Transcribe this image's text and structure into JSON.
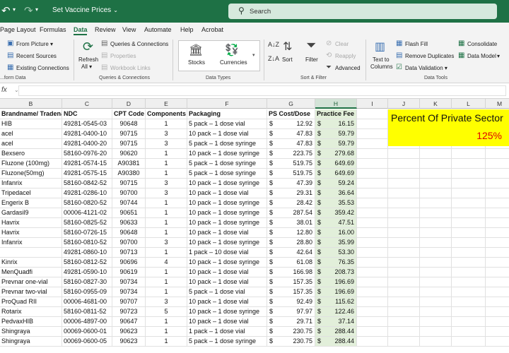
{
  "titlebar": {
    "doc_title": "Set Vaccine Prices",
    "search_placeholder": "Search"
  },
  "tabs": [
    "Page Layout",
    "Formulas",
    "Data",
    "Review",
    "View",
    "Automate",
    "Help",
    "Acrobat"
  ],
  "active_tab": "Data",
  "ribbon": {
    "get_data": {
      "from_picture": "From Picture",
      "recent_sources": "Recent Sources",
      "existing_connections": "Existing Connections",
      "label": "...form Data"
    },
    "queries": {
      "refresh_all": "Refresh",
      "refresh_all_2": "All",
      "queries_connections": "Queries & Connections",
      "properties": "Properties",
      "workbook_links": "Workbook Links",
      "label": "Queries & Connections"
    },
    "data_types": {
      "stocks": "Stocks",
      "currencies": "Currencies",
      "label": "Data Types"
    },
    "sort_filter": {
      "sort": "Sort",
      "filter": "Filter",
      "clear": "Clear",
      "reapply": "Reapply",
      "advanced": "Advanced",
      "label": "Sort & Filter"
    },
    "data_tools": {
      "text_to_columns": "Text to",
      "text_to_columns_2": "Columns",
      "flash_fill": "Flash Fill",
      "remove_duplicates": "Remove Duplicates",
      "data_validation": "Data Validation",
      "consolidate": "Consolidate",
      "data_model": "Data Model",
      "label": "Data Tools"
    }
  },
  "formula_bar": {
    "fx": "fx",
    "value": ""
  },
  "columns": [
    "B",
    "C",
    "D",
    "E",
    "F",
    "G",
    "H",
    "I",
    "J",
    "K",
    "L",
    "M"
  ],
  "selected_column": "H",
  "header_row": {
    "name": "Brandname/ Tradename",
    "ndc": "NDC",
    "cpt": "CPT Code",
    "components": "Components",
    "packaging": "Packaging",
    "ps_cost": "PS Cost/Dose",
    "practice_fee": "Practice Fee"
  },
  "banner": {
    "title": "Percent Of Private Sector",
    "value": "125%"
  },
  "rows": [
    {
      "name": "HIB",
      "ndc": "49281-0545-03",
      "cpt": "90648",
      "comp": "1",
      "pack": "5 pack – 1 dose vial",
      "cost": "12.92",
      "fee": "16.15"
    },
    {
      "name": "acel",
      "ndc": "49281-0400-10",
      "cpt": "90715",
      "comp": "3",
      "pack": "10 pack – 1 dose vial",
      "cost": "47.83",
      "fee": "59.79"
    },
    {
      "name": "acel",
      "ndc": "49281-0400-20",
      "cpt": "90715",
      "comp": "3",
      "pack": "5 pack – 1 dose syringe",
      "cost": "47.83",
      "fee": "59.79"
    },
    {
      "name": "Bexsero",
      "ndc": "58160-0976-20",
      "cpt": "90620",
      "comp": "1",
      "pack": "10 pack – 1 dose syringe",
      "cost": "223.75",
      "fee": "279.68"
    },
    {
      "name": "Fluzone (100mg)",
      "ndc": "49281-0574-15",
      "cpt": "A90381",
      "comp": "1",
      "pack": "5 pack – 1 dose syringe",
      "cost": "519.75",
      "fee": "649.69"
    },
    {
      "name": "Fluzone(50mg)",
      "ndc": "49281-0575-15",
      "cpt": "A90380",
      "comp": "1",
      "pack": "5 pack – 1 dose syringe",
      "cost": "519.75",
      "fee": "649.69"
    },
    {
      "name": "Infanrix",
      "ndc": "58160-0842-52",
      "cpt": "90715",
      "comp": "3",
      "pack": "10 pack – 1 dose syringe",
      "cost": "47.39",
      "fee": "59.24"
    },
    {
      "name": "Tripedacel",
      "ndc": "49281-0286-10",
      "cpt": "90700",
      "comp": "3",
      "pack": "10 pack – 1 dose vial",
      "cost": "29.31",
      "fee": "36.64"
    },
    {
      "name": "Engerix B",
      "ndc": "58160-0820-52",
      "cpt": "90744",
      "comp": "1",
      "pack": "10 pack – 1 dose syringe",
      "cost": "28.42",
      "fee": "35.53"
    },
    {
      "name": "Gardasil9",
      "ndc": "00006-4121-02",
      "cpt": "90651",
      "comp": "1",
      "pack": "10 pack – 1 dose syringe",
      "cost": "287.54",
      "fee": "359.42"
    },
    {
      "name": "Havrix",
      "ndc": "58160-0825-52",
      "cpt": "90633",
      "comp": "1",
      "pack": "10 pack – 1 dose syringe",
      "cost": "38.01",
      "fee": "47.51"
    },
    {
      "name": "Havrix",
      "ndc": "58160-0726-15",
      "cpt": "90648",
      "comp": "1",
      "pack": "10 pack – 1 dose vial",
      "cost": "12.80",
      "fee": "16.00"
    },
    {
      "name": "Infanrix",
      "ndc": "58160-0810-52",
      "cpt": "90700",
      "comp": "3",
      "pack": "10 pack – 1 dose syringe",
      "cost": "28.80",
      "fee": "35.99"
    },
    {
      "name": "",
      "ndc": "49281-0860-10",
      "cpt": "90713",
      "comp": "1",
      "pack": "1 pack – 10 dose vial",
      "cost": "42.64",
      "fee": "53.30"
    },
    {
      "name": "Kinrix",
      "ndc": "58160-0812-52",
      "cpt": "90696",
      "comp": "4",
      "pack": "10 pack – 1 dose syringe",
      "cost": "61.08",
      "fee": "76.35"
    },
    {
      "name": "MenQuadfi",
      "ndc": "49281-0590-10",
      "cpt": "90619",
      "comp": "1",
      "pack": "10 pack – 1 dose vial",
      "cost": "166.98",
      "fee": "208.73"
    },
    {
      "name": "Prevnar one-vial",
      "ndc": "58160-0827-30",
      "cpt": "90734",
      "comp": "1",
      "pack": "10 pack – 1 dose vial",
      "cost": "157.35",
      "fee": "196.69"
    },
    {
      "name": "Prevnar two-vial",
      "ndc": "58160-0955-09",
      "cpt": "90734",
      "comp": "1",
      "pack": "5 pack – 1 dose vial",
      "cost": "157.35",
      "fee": "196.69"
    },
    {
      "name": "ProQuad RII",
      "ndc": "00006-4681-00",
      "cpt": "90707",
      "comp": "3",
      "pack": "10 pack – 1 dose vial",
      "cost": "92.49",
      "fee": "115.62"
    },
    {
      "name": "Rotarix",
      "ndc": "58160-0811-52",
      "cpt": "90723",
      "comp": "5",
      "pack": "10 pack – 1 dose syringe",
      "cost": "97.97",
      "fee": "122.46"
    },
    {
      "name": "PedvaxHIB",
      "ndc": "00006-4897-00",
      "cpt": "90647",
      "comp": "1",
      "pack": "10 pack – 1 dose vial",
      "cost": "29.71",
      "fee": "37.14"
    },
    {
      "name": "Shingraya",
      "ndc": "00069-0600-01",
      "cpt": "90623",
      "comp": "1",
      "pack": "1 pack – 1 dose vial",
      "cost": "230.75",
      "fee": "288.44"
    },
    {
      "name": "Shingraya",
      "ndc": "00069-0600-05",
      "cpt": "90623",
      "comp": "1",
      "pack": "5 pack – 1 dose syringe",
      "cost": "230.75",
      "fee": "288.44"
    }
  ]
}
